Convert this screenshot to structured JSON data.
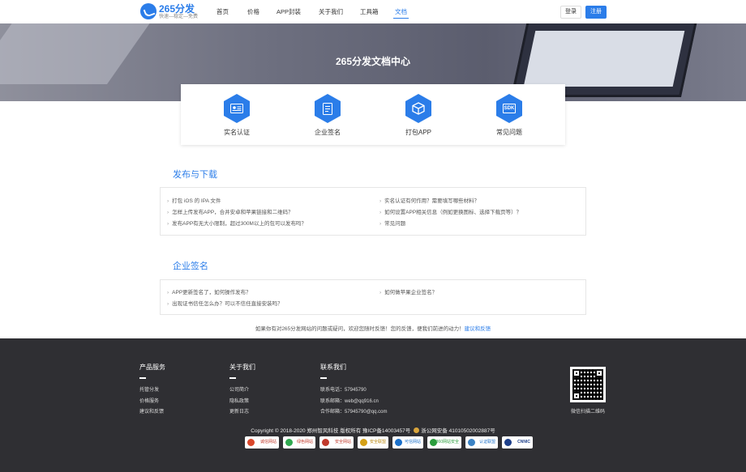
{
  "header": {
    "logo_title": "265分发",
    "logo_slogan": "快速—稳定—免费",
    "nav": [
      {
        "label": "首页"
      },
      {
        "label": "价格"
      },
      {
        "label": "APP封装"
      },
      {
        "label": "关于我们"
      },
      {
        "label": "工具箱"
      },
      {
        "label": "文档"
      }
    ],
    "active_nav": "文档",
    "login_label": "登录",
    "register_label": "注册"
  },
  "banner": {
    "title": "265分发文档中心"
  },
  "features": [
    {
      "label": "实名认证",
      "icon": "id-card-icon"
    },
    {
      "label": "企业签名",
      "icon": "document-icon"
    },
    {
      "label": "打包APP",
      "icon": "box-icon"
    },
    {
      "label": "常见问题",
      "icon": "sdk-icon",
      "icon_text": "SDK"
    }
  ],
  "sections": [
    {
      "title": "发布与下载",
      "left_items": [
        "打包 iOS 的 IPA 文件",
        "怎样上传发布APP，合并安卓和苹果链接和二维码？",
        "发布APP有无大小限制，超过300M以上的包可以发布吗？"
      ],
      "right_items": [
        "实名认证有何作用？需要填写哪些材料？",
        "如何设置APP相关信息（例如更换图标、选择下载页等）？",
        "常见问题"
      ]
    },
    {
      "title": "企业签名",
      "left_items": [
        "APP更新签名了，如何操作发布？",
        "出现证书信任怎么办？可以不信任直接安装吗？"
      ],
      "right_items": [
        "如何做苹果企业签名？"
      ]
    }
  ],
  "feedback": {
    "text": "如果你有对265分发网站的问题或疑问，欢迎您随时反馈！您的反馈，便我们前进的动力！",
    "link": "建议和反馈"
  },
  "footer": {
    "col1": {
      "title": "产品服务",
      "links": [
        "托管分发",
        "价格服务",
        "建议和反馈"
      ]
    },
    "col2": {
      "title": "关于我们",
      "links": [
        "公司简介",
        "隐私政策",
        "更新日志"
      ]
    },
    "col3": {
      "title": "联系我们",
      "links": [
        "联系电话：57945790",
        "联系邮箱：web@qq916.cn",
        "合作邮箱：57945790@qq.com"
      ]
    },
    "qr_label": "微信扫描二维码",
    "copyright": "Copyright © 2018-2020 郑州智风科技 版权所有 豫ICP备14003457号",
    "police": "浙公网安备 41010502002887号",
    "badges": [
      "诚信网站",
      "绿色网站",
      "安全网站",
      "安全联盟",
      "可信网站",
      "360网站安全",
      "认证联盟",
      "CNNIC"
    ]
  },
  "colors": {
    "accent": "#2b7de9",
    "footer_bg": "#2f2f33"
  }
}
